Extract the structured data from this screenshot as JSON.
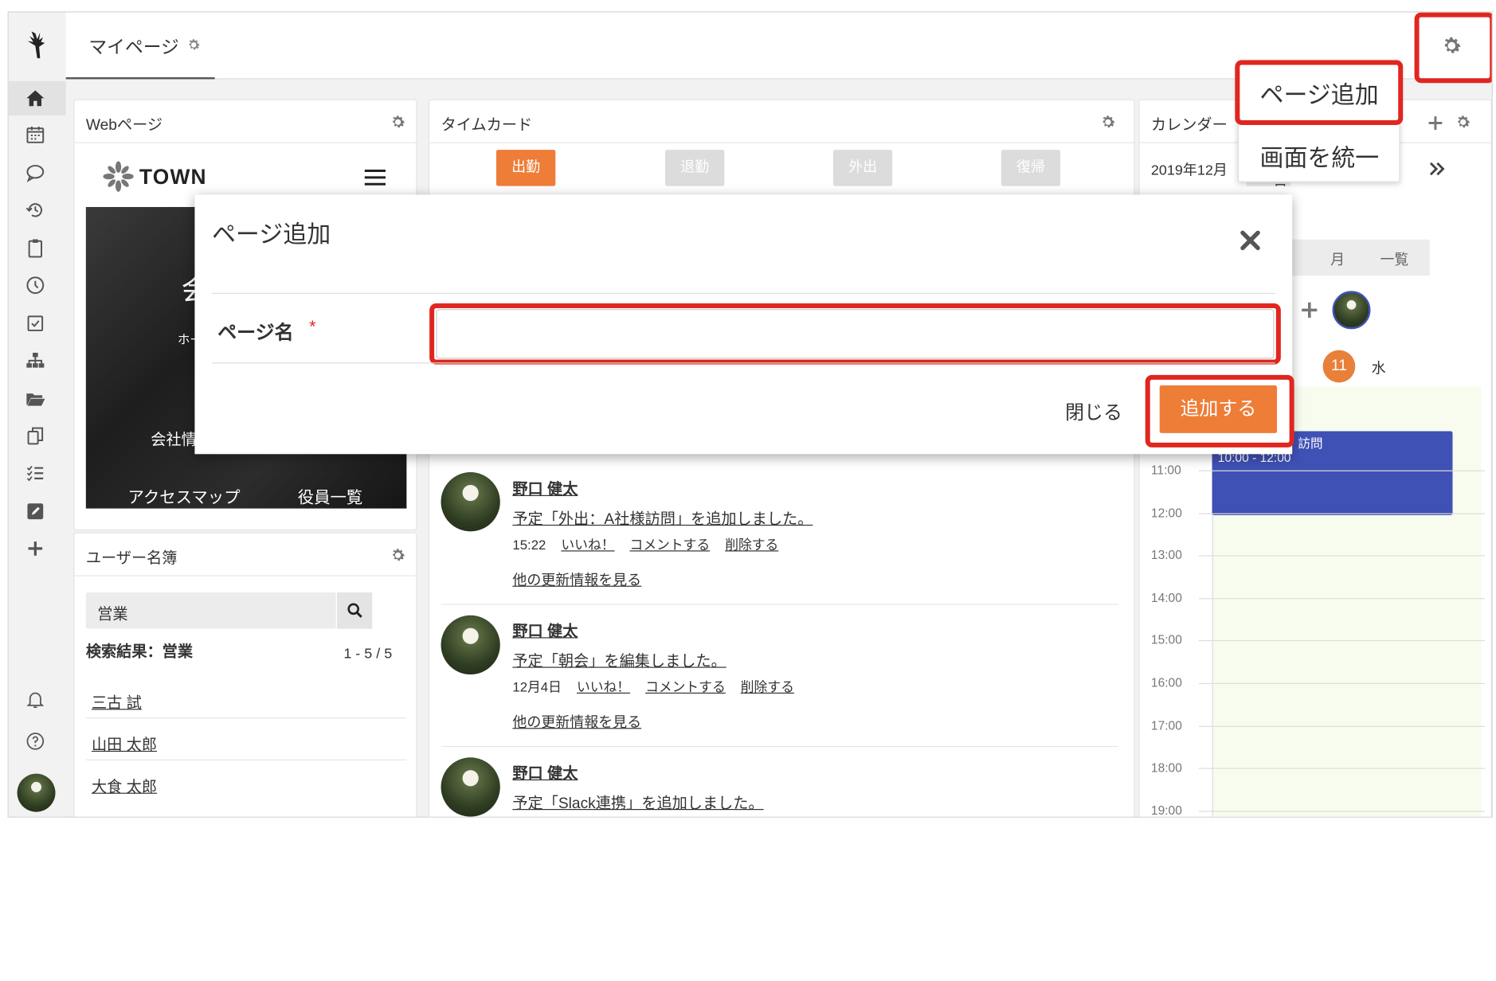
{
  "app": {
    "logo_icon": "stag-icon"
  },
  "tabs": [
    {
      "label": "マイページ",
      "icon": "gear-icon"
    }
  ],
  "header_settings_icon": "gear-icon",
  "settings_menu": {
    "items": [
      "ページ追加",
      "画面を統一"
    ]
  },
  "sidebar": {
    "items": [
      "home-icon",
      "calendar-icon",
      "chat-icon",
      "history-icon",
      "clipboard-icon",
      "clock-icon",
      "checkbox-icon",
      "org-chart-icon",
      "folder-icon",
      "copy-icon",
      "checklist-icon",
      "edit-icon",
      "plus-icon"
    ],
    "bottom_items": [
      "bell-icon",
      "help-icon",
      "avatar"
    ]
  },
  "web_panel": {
    "title": "Webページ",
    "brand": "TOWN",
    "menu_icon": "hamburger-icon",
    "hero_partial_text": "会",
    "hero_small_text": "ホー",
    "link_partial": "会社情",
    "links": [
      "アクセスマップ",
      "役員一覧"
    ]
  },
  "timecard": {
    "title": "タイムカード",
    "buttons": [
      {
        "label": "出勤",
        "active": true
      },
      {
        "label": "退勤",
        "active": false
      },
      {
        "label": "外出",
        "active": false
      },
      {
        "label": "復帰",
        "active": false
      }
    ]
  },
  "feed": [
    {
      "name": "野口 健太",
      "text": "予定「外出：A社様訪問」を追加しました。",
      "time": "15:22",
      "actions": [
        "いいね！",
        "コメントする",
        "削除する"
      ],
      "more": "他の更新情報を見る"
    },
    {
      "name": "野口 健太",
      "text": "予定「朝会」を編集しました。",
      "time": "12月4日",
      "actions": [
        "いいね！",
        "コメントする",
        "削除する"
      ],
      "more": "他の更新情報を見る"
    },
    {
      "name": "野口 健太",
      "text": "予定「Slack連携」を追加しました。"
    }
  ],
  "user_panel": {
    "title": "ユーザー名簿",
    "search_value": "営業",
    "result_label": "検索結果：営業",
    "result_count": "1 - 5 / 5",
    "users": [
      "三古 試",
      "山田 太郎",
      "大食 太郎"
    ]
  },
  "calendar": {
    "title": "カレンダー",
    "month": "2019年12月",
    "partial_button": "今日",
    "views": [
      "月",
      "一覧"
    ],
    "date": "11",
    "weekday": "水",
    "event_title": "訪問",
    "event_time": "10:00 - 12:00",
    "hours": [
      "11:00",
      "12:00",
      "13:00",
      "14:00",
      "15:00",
      "16:00",
      "17:00",
      "18:00",
      "19:00"
    ],
    "colors": {
      "event": "#3f51b5",
      "today": "#e8803a"
    }
  },
  "modal": {
    "title": "ページ追加",
    "field_label": "ページ名",
    "required_mark": "*",
    "field_value": "",
    "close_label": "閉じる",
    "submit_label": "追加する"
  },
  "colors": {
    "accent": "#ee7d38",
    "highlight": "#e0261f"
  }
}
